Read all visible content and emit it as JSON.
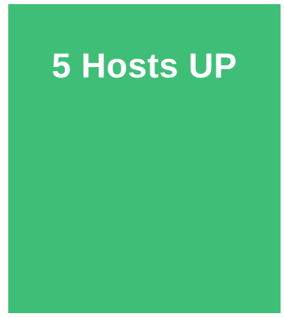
{
  "status_tile": {
    "count": "5",
    "label": "5 Hosts UP",
    "state": "up",
    "background_color": "#3fbe77",
    "text_color": "#ffffff"
  }
}
